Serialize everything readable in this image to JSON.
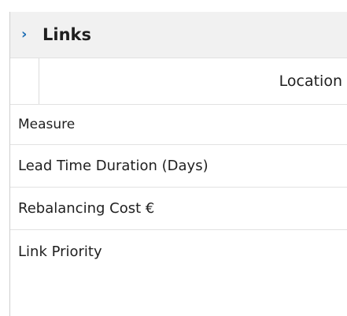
{
  "panel": {
    "title": "Links",
    "chevron_icon": "chevron-right-icon",
    "chevron_glyph": "›",
    "column_header": "Location",
    "rows": [
      {
        "label": "Measure"
      },
      {
        "label": "Lead Time Duration (Days)"
      },
      {
        "label": "Rebalancing Cost €"
      },
      {
        "label": "Link Priority"
      }
    ]
  },
  "colors": {
    "accent": "#1f6fb5",
    "header_bg": "#f1f1f1",
    "border": "#e2e2e2"
  }
}
